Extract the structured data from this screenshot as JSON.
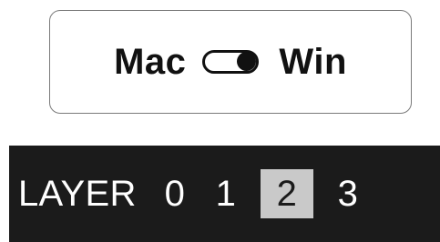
{
  "os_toggle": {
    "left_label": "Mac",
    "right_label": "Win",
    "selected": "Win"
  },
  "layer_selector": {
    "title": "LAYER",
    "layers": [
      "0",
      "1",
      "2",
      "3"
    ],
    "active_layer": "2"
  },
  "colors": {
    "bar_background": "#1b1b1b",
    "active_highlight": "#c9c9c9",
    "border": "#7a7a7a"
  }
}
